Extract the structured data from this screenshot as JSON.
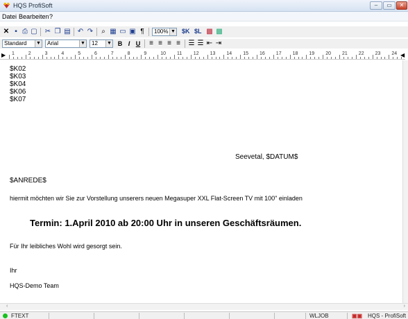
{
  "window": {
    "title": "HQS ProfiSoft",
    "min": "–",
    "max": "▭",
    "close": "✕"
  },
  "menu": [
    "Datei",
    "Bearbeiten",
    "?"
  ],
  "toolbar": {
    "zoom": "100%",
    "sk": "$K",
    "sl": "$L",
    "style": "Standard",
    "font": "Arial",
    "size": "12"
  },
  "ruler": [
    "1",
    "2",
    "3",
    "4",
    "5",
    "6",
    "7",
    "8",
    "9",
    "10",
    "11",
    "12",
    "13",
    "14",
    "15",
    "16",
    "17",
    "18",
    "19",
    "20",
    "21",
    "22",
    "23",
    "24"
  ],
  "document": {
    "k_lines": [
      "$K02",
      "$K03",
      "$K04",
      "$K06",
      "$K07"
    ],
    "date": "Seevetal, $DATUM$",
    "anrede": "$ANREDE$",
    "body1": "hiermit möchten wir Sie zur Vorstellung unserers neuen  Megasuper XXL Flat-Screen TV mit 100\" einladen",
    "termin": "Termin: 1.April 2010 ab 20:00 Uhr in unseren Geschäftsräumen.",
    "body2": "Für Ihr leibliches Wohl wird gesorgt sein.",
    "closing1": "Ihr",
    "closing2": "HQS-Demo Team"
  },
  "status": {
    "left": "FTEXT",
    "middle": "WLJOB",
    "right": "HQS - ProfiSoft"
  }
}
